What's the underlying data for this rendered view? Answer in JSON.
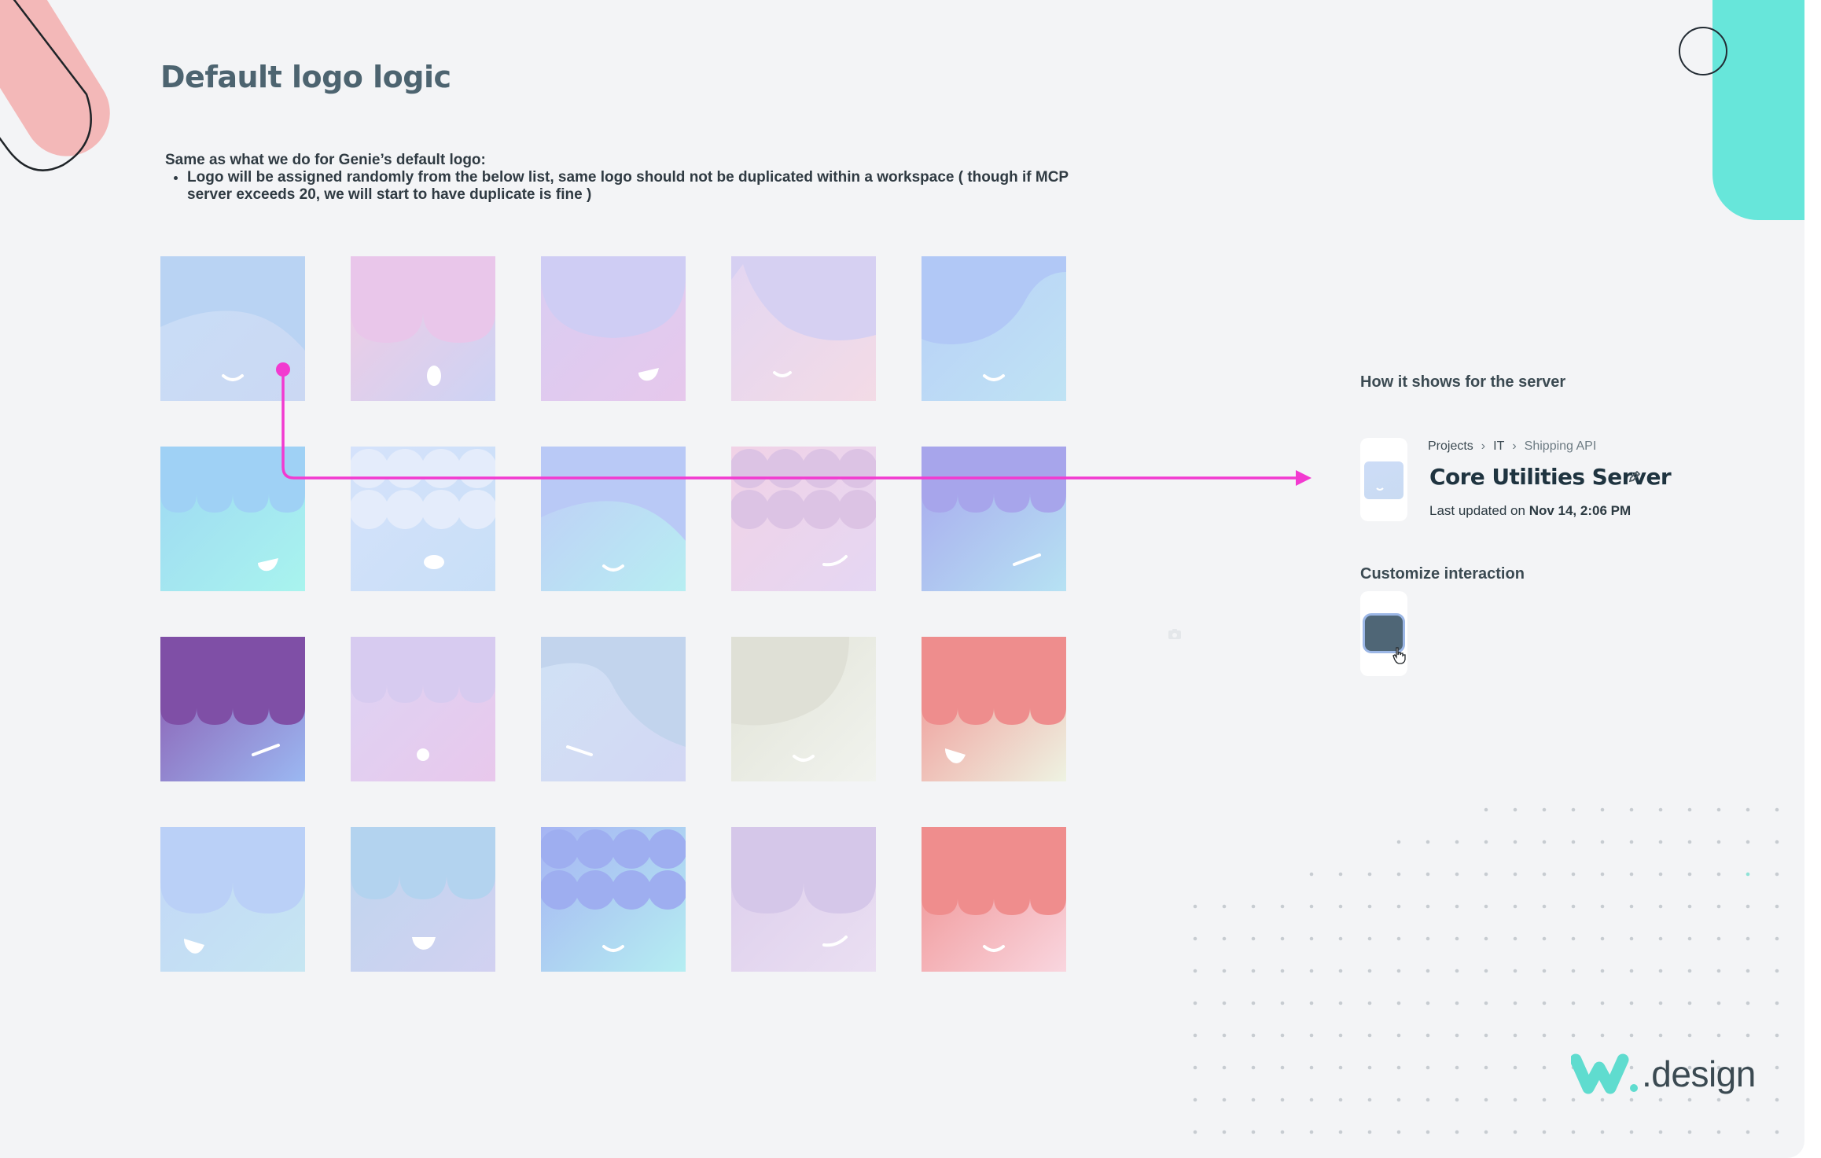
{
  "page": {
    "title": "Default logo logic",
    "description_intro": "Same as what we do for Genie’s default logo:",
    "description_bullet": "Logo will be assigned randomly from the below list, same logo should not be duplicated within a workspace ( though if MCP server exceeds 20, we will start to have duplicate is fine )"
  },
  "logos": [
    {
      "name": "logo-1",
      "bg": [
        "#c8def7",
        "#cbd8f3"
      ],
      "shape": "arc",
      "shape_color": "#b9d3f3",
      "face": "smile"
    },
    {
      "name": "logo-2",
      "bg": [
        "#f2cbe3",
        "#cdd3f4"
      ],
      "shape": "scallop2",
      "shape_color": "#e9c6ea",
      "face": "oval"
    },
    {
      "name": "logo-3",
      "bg": [
        "#d9cdf2",
        "#e6c8ec"
      ],
      "shape": "bigarc",
      "shape_color": "#cfcdf4",
      "face": "wink"
    },
    {
      "name": "logo-4",
      "bg": [
        "#e3d6f2",
        "#f3dbe6"
      ],
      "shape": "bigarc2",
      "shape_color": "#d6d0f2",
      "face": "smile-small"
    },
    {
      "name": "logo-5",
      "bg": [
        "#b8cff7",
        "#bfe3f4"
      ],
      "shape": "arc-right",
      "shape_color": "#b1c8f6",
      "face": "smile"
    },
    {
      "name": "logo-6",
      "bg": [
        "#9fd7f3",
        "#a8f4ee"
      ],
      "shape": "scallop4",
      "shape_color": "#9fd1f5",
      "face": "wink"
    },
    {
      "name": "logo-7",
      "bg": [
        "#d5e2fb",
        "#c8dff7"
      ],
      "shape": "bubbles",
      "shape_color": "#e4ecfb",
      "face": "oval-flat"
    },
    {
      "name": "logo-8",
      "bg": [
        "#c0cbf7",
        "#b7eef2"
      ],
      "shape": "arc",
      "shape_color": "#b9c9f6",
      "face": "smile"
    },
    {
      "name": "logo-9",
      "bg": [
        "#f1d2e6",
        "#e5d7f3"
      ],
      "shape": "bubbles",
      "shape_color": "#dcc3e4",
      "face": "smirk"
    },
    {
      "name": "logo-10",
      "bg": [
        "#a8a7ee",
        "#b6e2f3"
      ],
      "shape": "scallop4",
      "shape_color": "#a7a5eb",
      "face": "dash"
    },
    {
      "name": "logo-11",
      "bg": [
        "#8a55ac",
        "#9bb8f2"
      ],
      "shape": "scallop4-deep",
      "shape_color": "#7f4fa6",
      "face": "dash"
    },
    {
      "name": "logo-12",
      "bg": [
        "#ddd4f4",
        "#e8c8ec"
      ],
      "shape": "scallop4",
      "shape_color": "#d7cbf0",
      "face": "dot"
    },
    {
      "name": "logo-13",
      "bg": [
        "#d0e2f5",
        "#d3d7f4"
      ],
      "shape": "arc-big-right",
      "shape_color": "#c2d4ed",
      "face": "dash-left"
    },
    {
      "name": "logo-14",
      "bg": [
        "#e1e3d7",
        "#f1f3ee"
      ],
      "shape": "arc-corner",
      "shape_color": "#dfe0d6",
      "face": "smile"
    },
    {
      "name": "logo-15",
      "bg": [
        "#f09090",
        "#eef3e2"
      ],
      "shape": "scallop4-deep",
      "shape_color": "#ee8d8d",
      "face": "wink-left"
    },
    {
      "name": "logo-16",
      "bg": [
        "#c2d6f7",
        "#c6e6f2"
      ],
      "shape": "scallop2",
      "shape_color": "#bad0f7",
      "face": "wink-left"
    },
    {
      "name": "logo-17",
      "bg": [
        "#bed6ee",
        "#d2d1f1"
      ],
      "shape": "scallop3",
      "shape_color": "#b3d3ef",
      "face": "wink-center"
    },
    {
      "name": "logo-18",
      "bg": [
        "#a6b4f3",
        "#b5eef2"
      ],
      "shape": "bubbles",
      "shape_color": "#9eaef0",
      "face": "smile"
    },
    {
      "name": "logo-19",
      "bg": [
        "#dccdec",
        "#eadff2"
      ],
      "shape": "scallop2",
      "shape_color": "#d5c7e9",
      "face": "smirk"
    },
    {
      "name": "logo-20",
      "bg": [
        "#ef8e8e",
        "#f9d6df"
      ],
      "shape": "scallop4-deep",
      "shape_color": "#ef8d8d",
      "face": "smile"
    }
  ],
  "server_preview": {
    "heading": "How it shows for the server",
    "breadcrumb": [
      "Projects",
      "IT",
      "Shipping API"
    ],
    "breadcrumb_separator": "›",
    "server_name": "Core Utilities Server",
    "updated_prefix": "Last updated on",
    "updated_value": "Nov 14, 2:06 PM"
  },
  "interaction": {
    "heading": "Customize interaction"
  },
  "brand": {
    "suffix": ".design",
    "accent": "#5fdccf"
  },
  "colors": {
    "connector": "#f23ad0",
    "teal": "#67e6da",
    "pink": "#f3b8b8"
  },
  "icons": [
    "pencil-icon",
    "cursor-hand-icon",
    "camera-icon",
    "brand-w-logo"
  ]
}
